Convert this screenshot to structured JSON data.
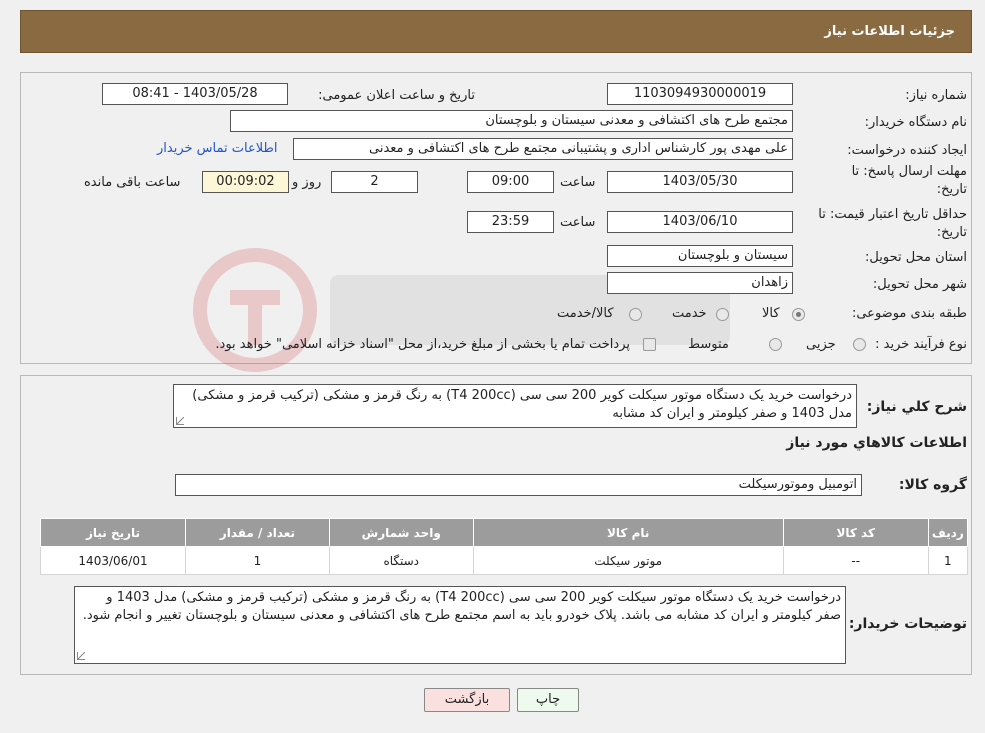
{
  "header": {
    "title": "جزئیات اطلاعات نیاز"
  },
  "form": {
    "need_number": {
      "label": "شماره نیاز:",
      "value": "1103094930000019"
    },
    "announce_datetime": {
      "label": "تاریخ و ساعت اعلان عمومی:",
      "value": "1403/05/28 - 08:41"
    },
    "buyer_org": {
      "label": "نام دستگاه خریدار:",
      "value": "مجتمع طرح های اکتشافی و معدنی سیستان و بلوچستان"
    },
    "requester": {
      "label": "ایجاد کننده درخواست:",
      "value": "علی مهدی پور کارشناس اداری و پشتیبانی مجتمع طرح های اکتشافی و معدنی"
    },
    "contact_link": "اطلاعات تماس خریدار",
    "response_deadline": {
      "label_line1": "مهلت ارسال پاسخ: تا",
      "label_line2": "تاریخ:",
      "date": "1403/05/30",
      "time_label": "ساعت",
      "time": "09:00",
      "days": "2",
      "days_label": "روز و",
      "remaining": "00:09:02",
      "remaining_label": "ساعت باقی مانده"
    },
    "price_validity": {
      "label_line1": "حداقل تاریخ اعتبار قیمت: تا",
      "label_line2": "تاریخ:",
      "date": "1403/06/10",
      "time_label": "ساعت",
      "time": "23:59"
    },
    "delivery_province": {
      "label": "استان محل تحویل:",
      "value": "سیستان و بلوچستان"
    },
    "delivery_city": {
      "label": "شهر محل تحویل:",
      "value": "زاهدان"
    },
    "category": {
      "label": "طبقه بندی موضوعی:",
      "options": [
        "کالا",
        "خدمت",
        "کالا/خدمت"
      ],
      "selected": "کالا"
    },
    "purchase_type": {
      "label": "نوع فرآیند خرید :",
      "options": [
        "جزیی",
        "متوسط"
      ],
      "note": "پرداخت تمام یا بخشی از مبلغ خرید،از محل \"اسناد خزانه اسلامی\" خواهد بود."
    }
  },
  "summary": {
    "label": "شرح کلي نياز:",
    "value": "درخواست خرید یک دستگاه موتور سیکلت کویر 200 سی سی (T4 200cc) به رنگ قرمز و مشکی (ترکیب قرمز و مشکی) مدل 1403 و صفر کیلومتر و ایران کد مشابه"
  },
  "items_section": {
    "title": "اطلاعات کالاهاي مورد نياز",
    "group_label": "گروه کالا:",
    "group_value": "اتومبیل وموتورسیکلت"
  },
  "table": {
    "headers": [
      "ردیف",
      "کد کالا",
      "نام کالا",
      "واحد شمارش",
      "تعداد / مقدار",
      "تاریخ نیاز"
    ],
    "rows": [
      [
        "1",
        "--",
        "موتور سیکلت",
        "دستگاه",
        "1",
        "1403/06/01"
      ]
    ]
  },
  "buyer_notes": {
    "label": "توضیحات خریدار:",
    "value": "درخواست خرید یک دستگاه موتور سیکلت کویر 200 سی سی (T4 200cc) به رنگ قرمز و مشکی (ترکیب قرمز و مشکی) مدل 1403 و صفر کیلومتر و ایران کد مشابه می باشد. پلاک خودرو باید به اسم مجتمع طرح های اکتشافی و معدنی سیستان و بلوچستان تغییر و انجام شود."
  },
  "buttons": {
    "print": "چاپ",
    "back": "بازگشت"
  },
  "colors": {
    "header_bg": "#8a6a40",
    "table_header_bg": "#9c9c9c",
    "link": "#2255cc"
  }
}
